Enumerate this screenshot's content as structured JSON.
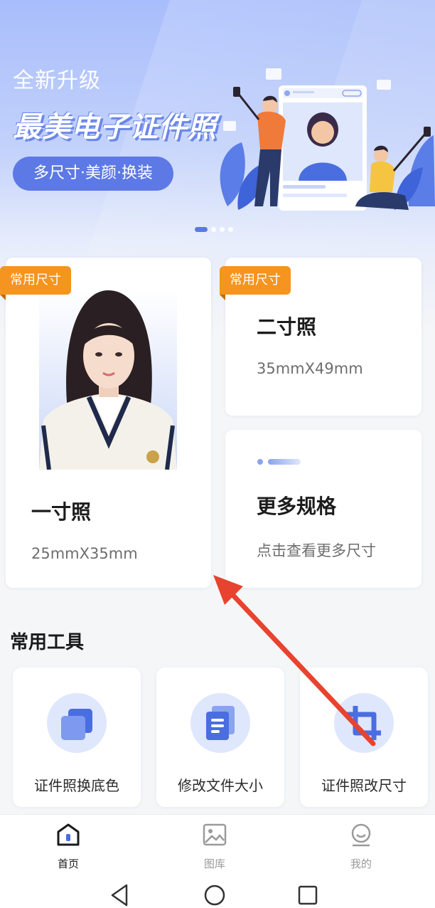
{
  "banner": {
    "subtitle": "全新升级",
    "title": "最美电子证件照",
    "pill": "多尺寸·美颜·换装",
    "carousel_pages": 4,
    "carousel_active": 1
  },
  "size_cards": {
    "one_inch": {
      "tag": "常用尺寸",
      "title": "一寸照",
      "spec": "25mmX35mm"
    },
    "two_inch": {
      "tag": "常用尺寸",
      "title": "二寸照",
      "spec": "35mmX49mm"
    },
    "more": {
      "title": "更多规格",
      "spec": "点击查看更多尺寸"
    }
  },
  "tools": {
    "section_title": "常用工具",
    "items": [
      {
        "label": "证件照换底色",
        "icon": "layers-icon"
      },
      {
        "label": "修改文件大小",
        "icon": "document-icon"
      },
      {
        "label": "证件照改尺寸",
        "icon": "crop-icon"
      }
    ]
  },
  "tabbar": {
    "items": [
      {
        "label": "首页",
        "icon": "home-icon",
        "active": true
      },
      {
        "label": "图库",
        "icon": "gallery-icon",
        "active": false
      },
      {
        "label": "我的",
        "icon": "profile-icon",
        "active": false
      }
    ]
  },
  "colors": {
    "accent": "#4a6ee0",
    "tag_orange": "#f5941e",
    "annotation_red": "#e8432f",
    "icon_blue": "#5b7de8",
    "icon_bg": "#dfe7fd"
  }
}
